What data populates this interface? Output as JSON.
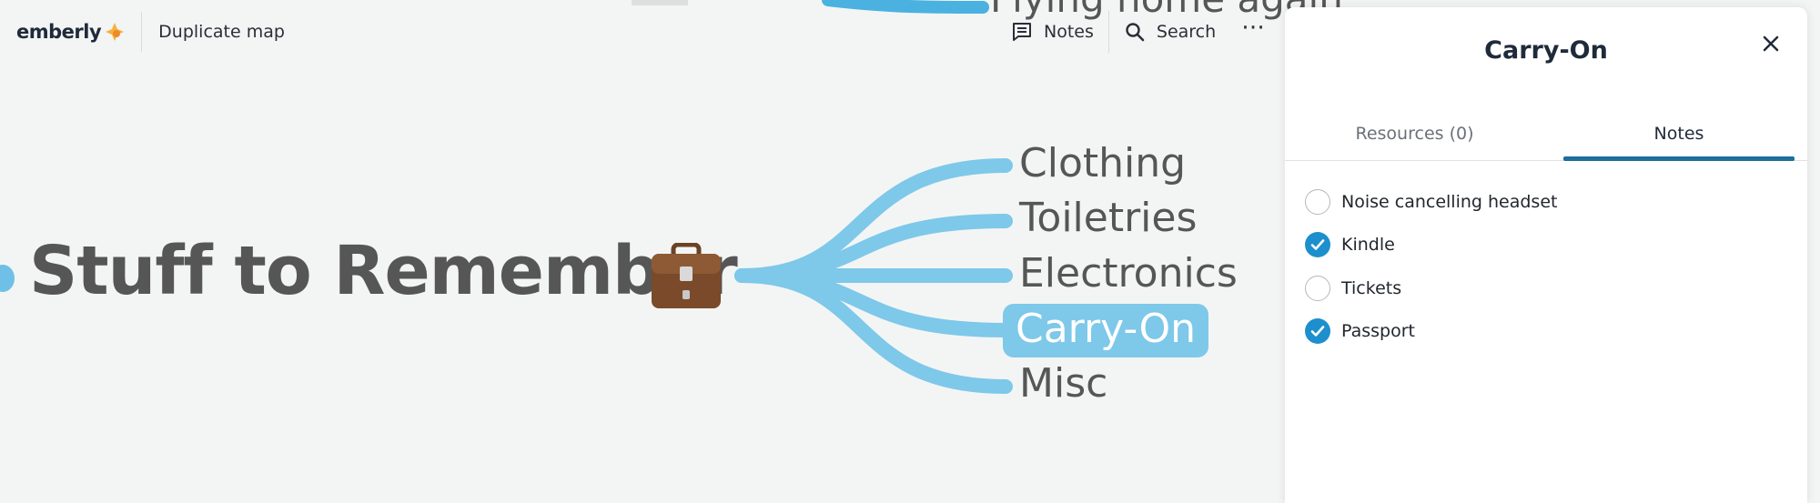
{
  "app": {
    "logo_text": "emberly",
    "duplicate_label": "Duplicate map"
  },
  "toolbar": {
    "notes_label": "Notes",
    "search_label": "Search",
    "more_label": "⋯"
  },
  "mindmap": {
    "central_topic": "Stuff to Remember",
    "central_emoji": "briefcase-icon",
    "partial_topic_above": "Flying home again",
    "branches": [
      {
        "label": "Clothing",
        "selected": false
      },
      {
        "label": "Toiletries",
        "selected": false
      },
      {
        "label": "Electronics",
        "selected": false
      },
      {
        "label": "Carry-On",
        "selected": true
      },
      {
        "label": "Misc",
        "selected": false
      }
    ],
    "branch_color": "#7ec8ea"
  },
  "panel": {
    "title": "Carry-On",
    "tabs": [
      {
        "label": "Resources (0)",
        "active": false
      },
      {
        "label": "Notes",
        "active": true
      }
    ],
    "checklist": [
      {
        "label": "Noise cancelling headset",
        "checked": false
      },
      {
        "label": "Kindle",
        "checked": true
      },
      {
        "label": "Tickets",
        "checked": false
      },
      {
        "label": "Passport",
        "checked": true
      }
    ],
    "accent_color": "#1d8fcc",
    "tab_underline_color": "#1e6f99"
  }
}
